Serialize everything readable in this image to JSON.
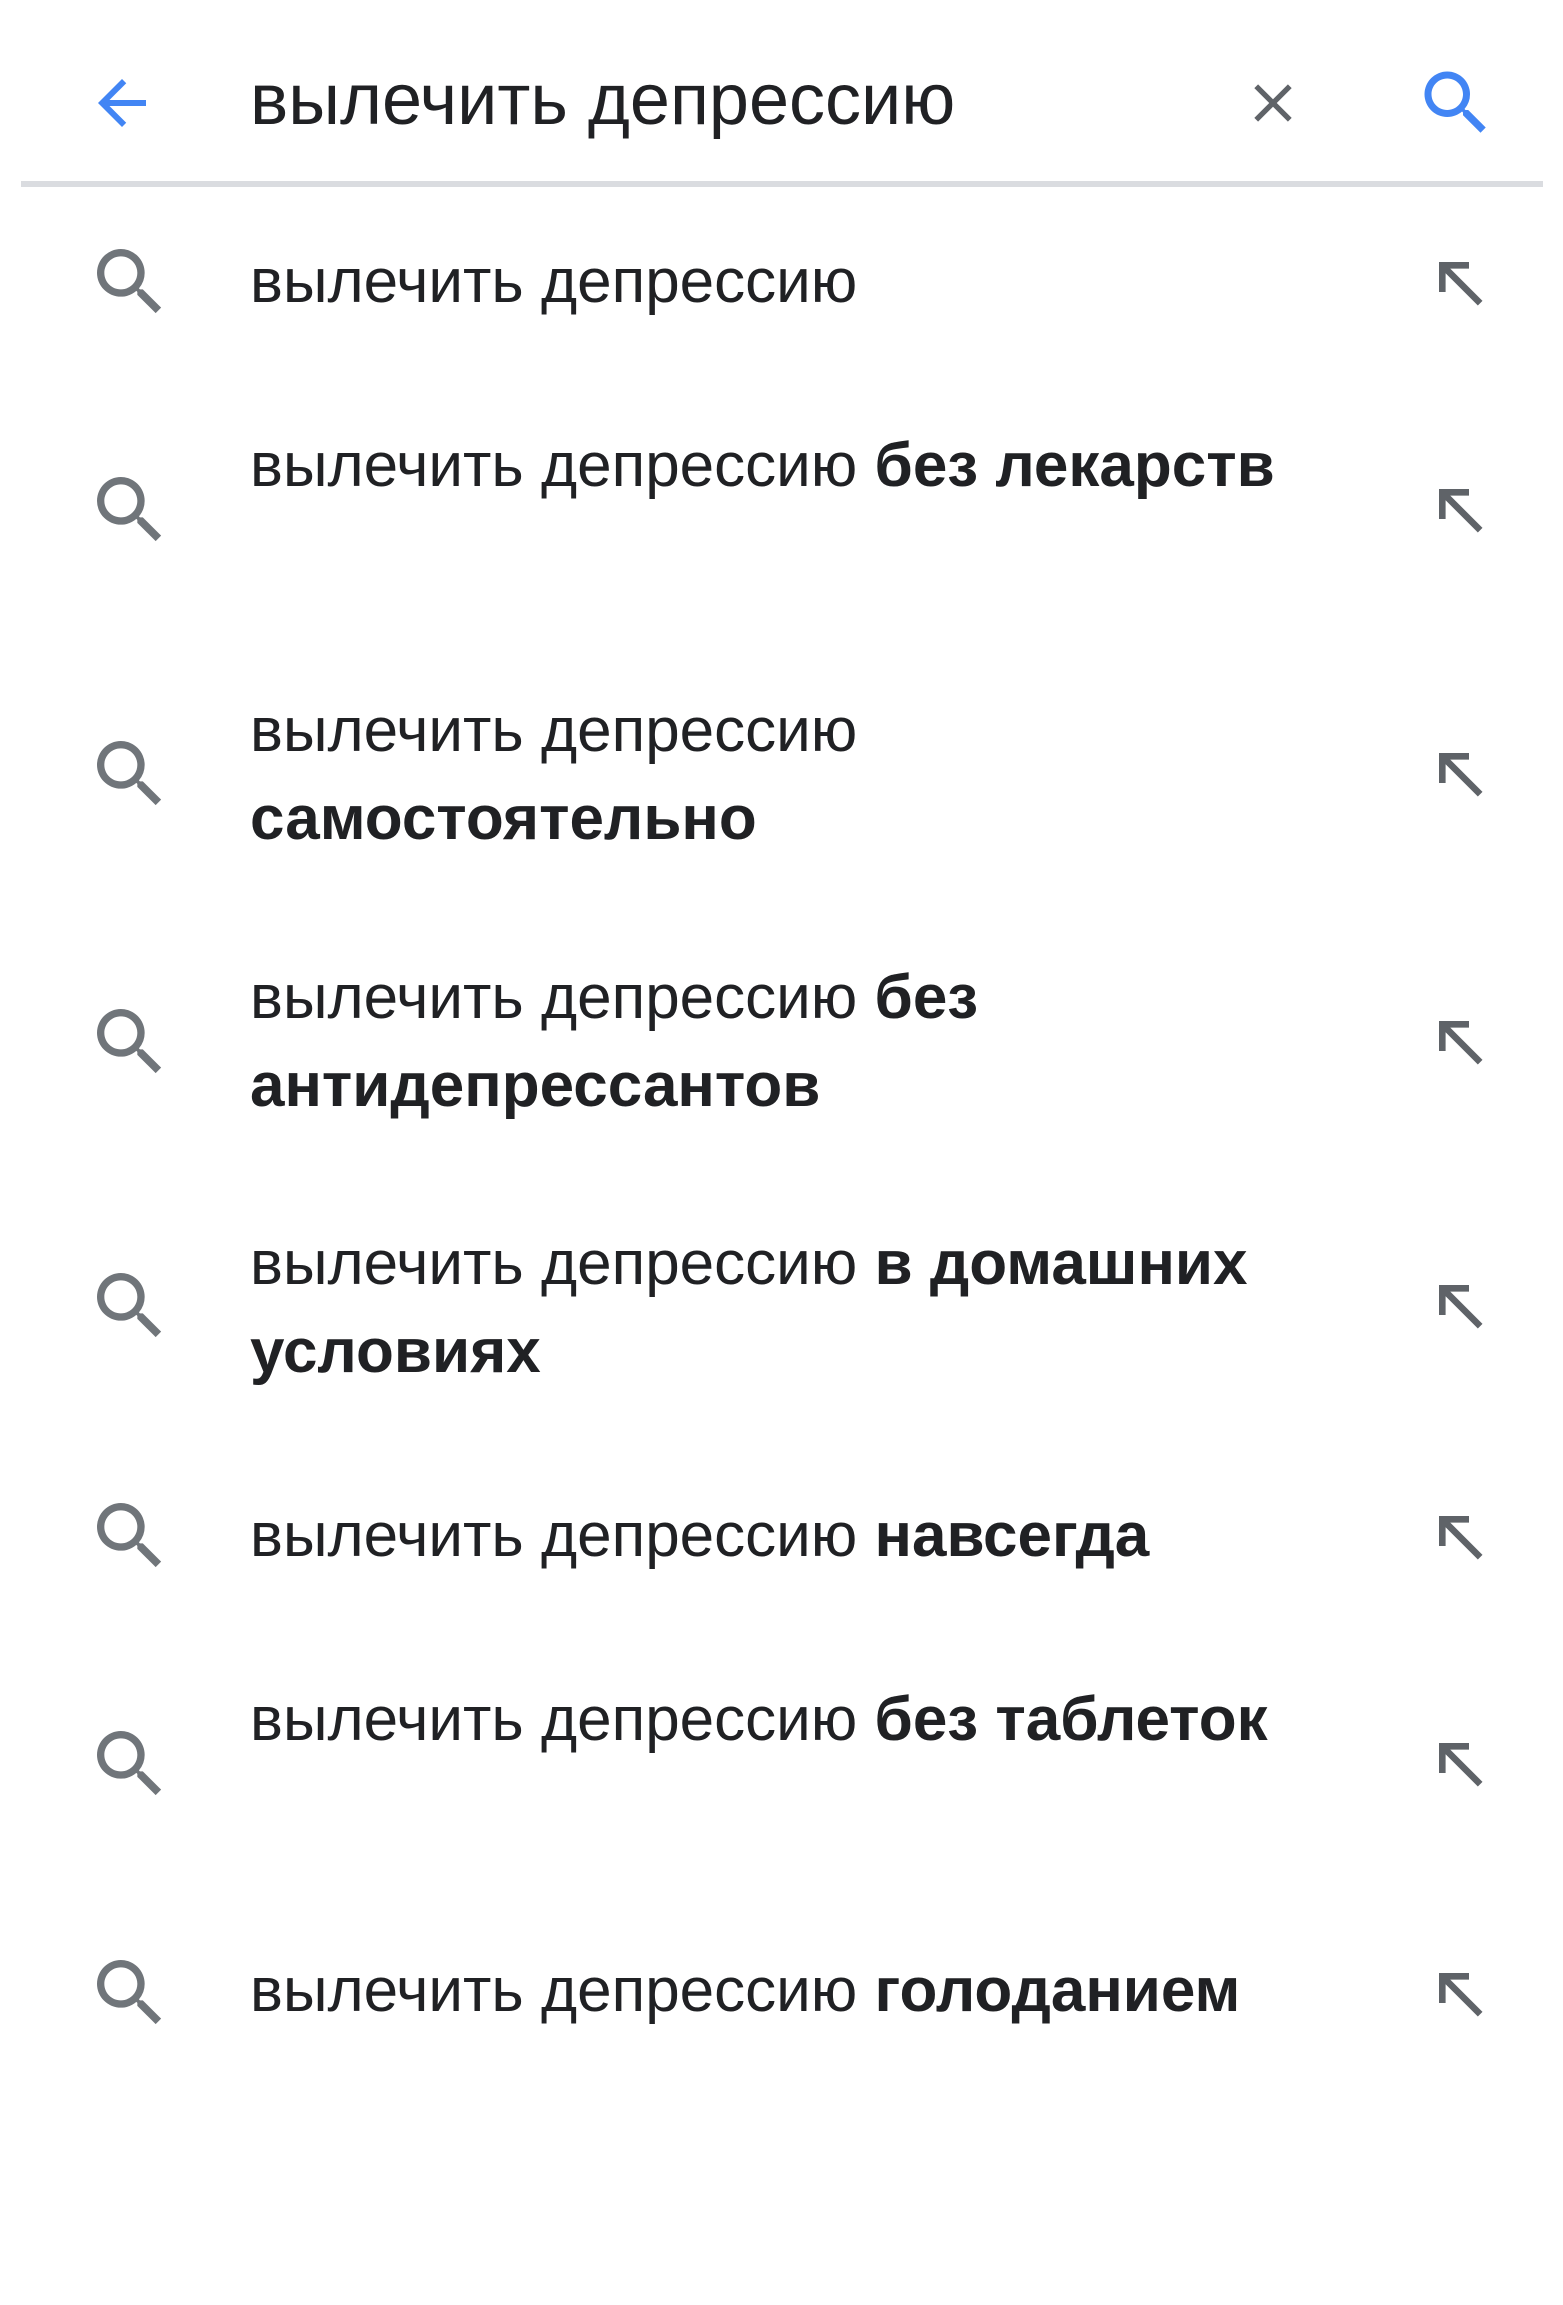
{
  "search": {
    "query": "вылечить депрессию",
    "back_icon": "arrow-left-icon",
    "clear_icon": "close-icon",
    "submit_icon": "search-icon"
  },
  "colors": {
    "accent": "#4285F4",
    "icon_gray": "#70757a",
    "text": "#202124",
    "divider": "#dadce0"
  },
  "suggestions": [
    {
      "prefix": "вылечить депрессию",
      "suffix": ""
    },
    {
      "prefix": "вылечить депрессию",
      "suffix": "без лекарств"
    },
    {
      "prefix": "вылечить депрессию",
      "suffix": "самостоятельно"
    },
    {
      "prefix": "вылечить депрессию",
      "suffix": "без антидепрессантов"
    },
    {
      "prefix": "вылечить депрессию",
      "suffix": "в домашних условиях"
    },
    {
      "prefix": "вылечить депрессию",
      "suffix": "навсегда"
    },
    {
      "prefix": "вылечить депрессию",
      "suffix": "без таблеток"
    },
    {
      "prefix": "вылечить депрессию",
      "suffix": "голоданием"
    }
  ]
}
